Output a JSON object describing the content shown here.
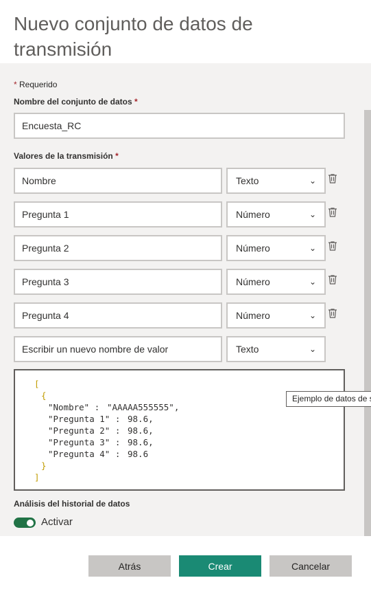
{
  "title": "Nuevo conjunto de datos de transmisión",
  "required_note": "Requerido",
  "dataset_name": {
    "label": "Nombre del conjunto de datos",
    "value": "Encuesta_RC"
  },
  "stream_values": {
    "label": "Valores de la transmisión",
    "rows": [
      {
        "name": "Nombre",
        "type": "Texto",
        "deletable": true
      },
      {
        "name": "Pregunta 1",
        "type": "Número",
        "deletable": true
      },
      {
        "name": "Pregunta 2",
        "type": "Número",
        "deletable": true
      },
      {
        "name": "Pregunta 3",
        "type": "Número",
        "deletable": true
      },
      {
        "name": "Pregunta 4",
        "type": "Número",
        "deletable": true
      }
    ],
    "new_row": {
      "placeholder": "Escribir un nuevo nombre de valor",
      "type": "Texto"
    }
  },
  "json_sample": {
    "lines": [
      "[",
      "{",
      "\"Nombre\" :",
      "\"AAAAA555555\",",
      "\"Pregunta 1\" :",
      "98.6,",
      "\"Pregunta 2\" :",
      "98.6,",
      "\"Pregunta 3\" :",
      "98.6,",
      "\"Pregunta 4\" :",
      "98.6",
      "}",
      "]"
    ]
  },
  "tooltip": "Ejemplo de datos de s",
  "history": {
    "label": "Análisis del historial de datos",
    "toggle_label": "Activar",
    "enabled": true
  },
  "buttons": {
    "back": "Atrás",
    "create": "Crear",
    "cancel": "Cancelar"
  },
  "colors": {
    "accent": "#1a8a74",
    "toggle": "#217346",
    "required_star": "#a4262c"
  },
  "icons": {
    "delete": "trash-icon",
    "dropdown": "chevron-down-icon"
  }
}
